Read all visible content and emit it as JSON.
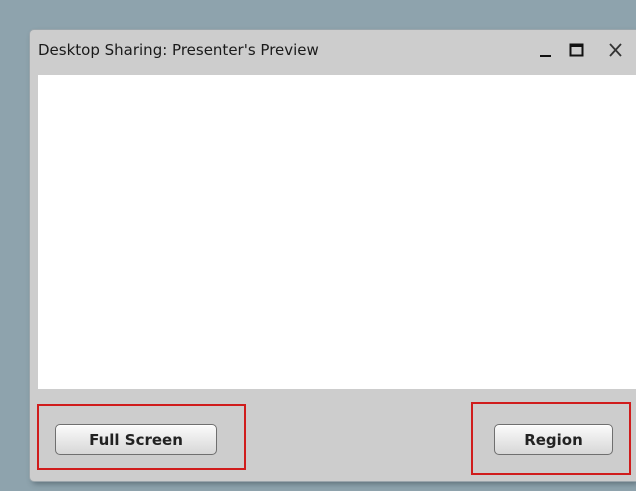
{
  "window": {
    "title": "Desktop Sharing: Presenter's Preview",
    "controls": [
      "minimize-icon",
      "maximize-icon",
      "close-icon"
    ]
  },
  "footer": {
    "full_screen_label": "Full Screen",
    "region_label": "Region"
  },
  "colors": {
    "background": "#8ea3ad",
    "window": "#cdcdcd",
    "preview": "#ffffff",
    "highlight": "#d01c1c"
  }
}
